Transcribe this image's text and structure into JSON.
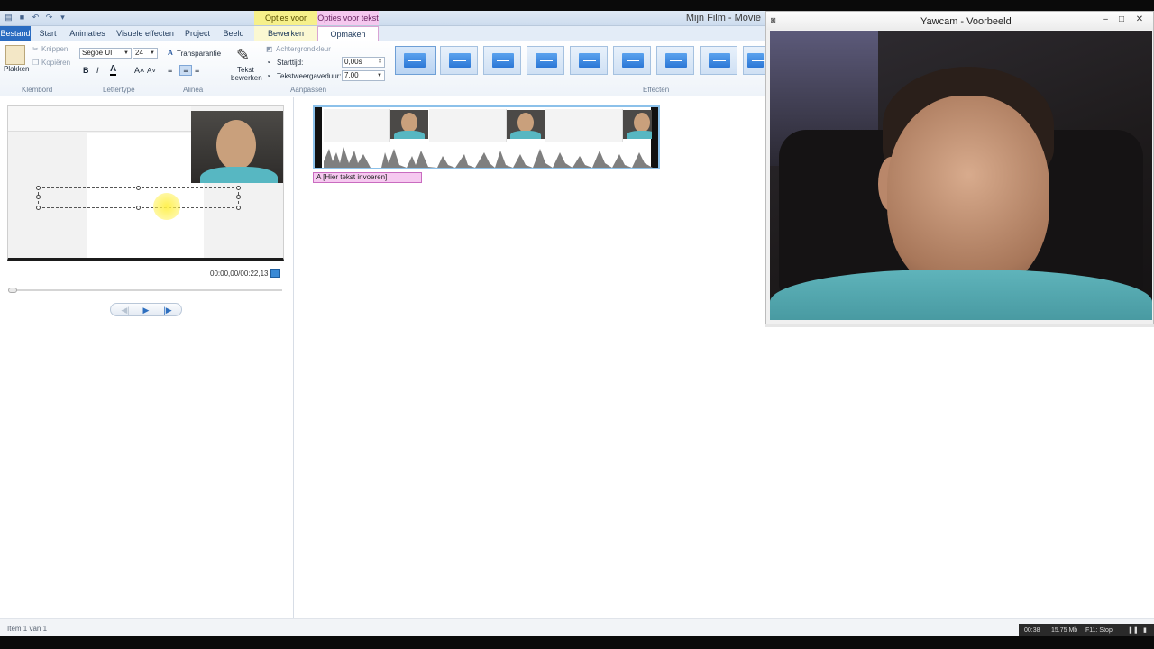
{
  "movie_maker": {
    "window_title": "Mijn Film - Movie",
    "context_tabs": {
      "video": "Opties voor video",
      "text": "Opties voor tekst"
    },
    "tabs": [
      "Bestand",
      "Start",
      "Animaties",
      "Visuele effecten",
      "Project",
      "Beeld",
      "Bewerken",
      "Opmaken"
    ],
    "ribbon": {
      "clipboard": {
        "paste": "Plakken",
        "cut": "Knippen",
        "copy": "Kopiëren",
        "group": "Klembord"
      },
      "font": {
        "family": "Segoe UI",
        "size": "24",
        "transparency": "Transparantie",
        "group": "Lettertype",
        "bold": "B",
        "italic": "I",
        "color": "A"
      },
      "paragraph": {
        "group": "Alinea"
      },
      "edit_text": {
        "line1": "Tekst",
        "line2": "bewerken"
      },
      "adjust": {
        "background_color": "Achtergrondkleur",
        "start_time_label": "Starttijd:",
        "start_time": "0,00s",
        "duration_label": "Tekstweergaveduur:",
        "duration": "7,00",
        "group": "Aanpassen"
      },
      "effects": {
        "group": "Effecten"
      }
    },
    "preview": {
      "time": "00:00,00/00:22,13"
    },
    "caption": "[Hier tekst invoeren]",
    "status": "Item 1 van 1"
  },
  "recorder": {
    "elapsed": "00:38",
    "size": "15.75 Mb",
    "hint": "F11: Stop"
  },
  "yawcam": {
    "title": "Yawcam - Voorbeeld",
    "min": "–",
    "max": "□",
    "close": "✕"
  }
}
